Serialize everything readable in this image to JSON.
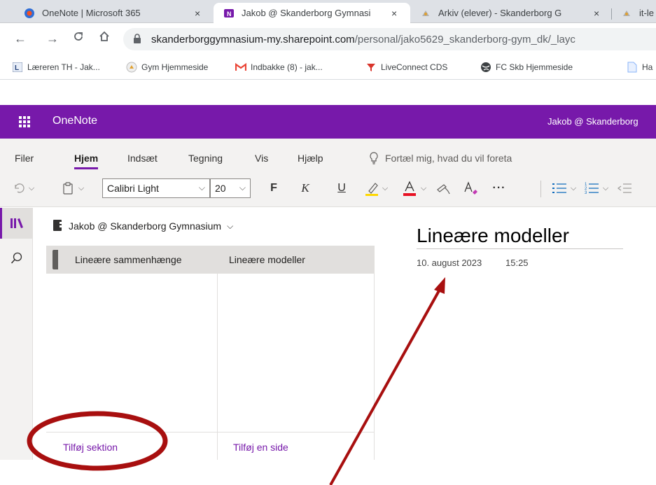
{
  "browser": {
    "tabs": [
      {
        "title": "OneNote | Microsoft 365",
        "close": "×"
      },
      {
        "title": "Jakob @ Skanderborg Gymnasi",
        "close": "×"
      },
      {
        "title": "Arkiv (elever) - Skanderborg G",
        "close": "×"
      },
      {
        "title": "it-le"
      }
    ],
    "url_host": "skanderborggymnasium-my.sharepoint.com",
    "url_path": "/personal/jako5629_skanderborg-gym_dk/_layc",
    "bookmarks": [
      {
        "label": "Læreren TH - Jak...",
        "icon": "lectio-icon"
      },
      {
        "label": "Gym Hjemmeside",
        "icon": "school-icon"
      },
      {
        "label": "Indbakke (8) - jak...",
        "icon": "gmail-icon"
      },
      {
        "label": "LiveConnect CDS",
        "icon": "filter-icon"
      },
      {
        "label": "FC Skb Hjemmeside",
        "icon": "globe-icon"
      },
      {
        "label": "Ha",
        "icon": "document-icon"
      }
    ]
  },
  "app": {
    "name": "OneNote",
    "user": "Jakob @ Skanderborg"
  },
  "ribbon": {
    "tabs": [
      "Filer",
      "Hjem",
      "Indsæt",
      "Tegning",
      "Vis",
      "Hjælp"
    ],
    "active_tab": "Hjem",
    "tell_me": "Fortæl mig, hvad du vil foreta",
    "font_name": "Calibri Light",
    "font_size": "20",
    "bold": "F",
    "italic": "K",
    "underline": "U",
    "more": "···"
  },
  "notebook": {
    "name": "Jakob @ Skanderborg Gymnasium",
    "sections": [
      "Lineære sammenhænge"
    ],
    "pages": [
      "Lineære modeller"
    ],
    "add_section": "Tilføj sektion",
    "add_page": "Tilføj en side"
  },
  "page": {
    "title": "Lineære modeller",
    "date": "10. august 2023",
    "time": "15:25"
  },
  "colors": {
    "brand": "#7719aa",
    "annotation": "#a80f0f",
    "highlight": "#ffd800",
    "font_color": "#e81123"
  }
}
